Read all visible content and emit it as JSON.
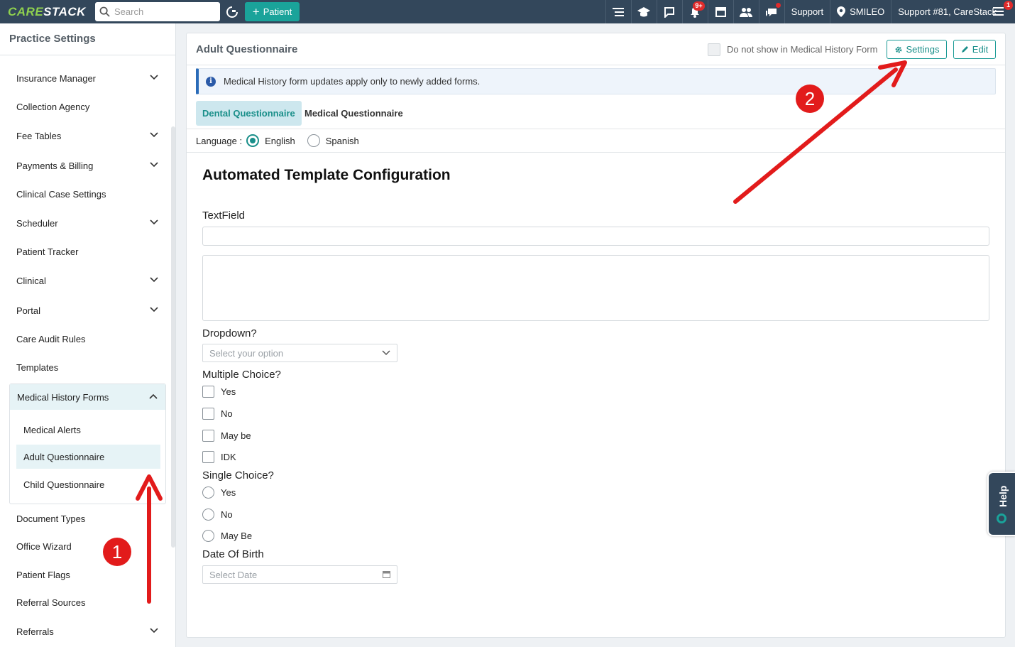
{
  "topbar": {
    "logo_part1": "CARE",
    "logo_part2": "STACK",
    "search_placeholder": "Search",
    "patient_button": "Patient",
    "notifications_badge": "9+",
    "support": "Support",
    "location": "SMILEO",
    "user": "Support #81, CareStack",
    "user_badge": "1"
  },
  "sidebar": {
    "title": "Practice Settings",
    "items": [
      {
        "label": "Insurance Manager",
        "expandable": true
      },
      {
        "label": "Collection Agency",
        "expandable": false
      },
      {
        "label": "Fee Tables",
        "expandable": true
      },
      {
        "label": "Payments & Billing",
        "expandable": true
      },
      {
        "label": "Clinical Case Settings",
        "expandable": false
      },
      {
        "label": "Scheduler",
        "expandable": true
      },
      {
        "label": "Patient Tracker",
        "expandable": false
      },
      {
        "label": "Clinical",
        "expandable": true
      },
      {
        "label": "Portal",
        "expandable": true
      },
      {
        "label": "Care Audit Rules",
        "expandable": false
      },
      {
        "label": "Templates",
        "expandable": false
      }
    ],
    "group": {
      "label": "Medical History Forms",
      "children": [
        "Medical Alerts",
        "Adult Questionnaire",
        "Child Questionnaire"
      ],
      "active_child": "Adult Questionnaire"
    },
    "items_after": [
      {
        "label": "Document Types",
        "expandable": false
      },
      {
        "label": "Office Wizard",
        "expandable": false
      },
      {
        "label": "Patient Flags",
        "expandable": false
      },
      {
        "label": "Referral Sources",
        "expandable": false
      },
      {
        "label": "Referrals",
        "expandable": true
      }
    ]
  },
  "panel": {
    "title": "Adult Questionnaire",
    "hide_checkbox_label": "Do not show in Medical History Form",
    "settings_button": "Settings",
    "edit_button": "Edit",
    "info_message": "Medical History form updates apply only to newly added forms.",
    "tabs": [
      {
        "label": "Dental Questionnaire",
        "active": true
      },
      {
        "label": "Medical Questionnaire",
        "active": false
      }
    ],
    "language_label": "Language :",
    "languages": [
      {
        "label": "English",
        "selected": true
      },
      {
        "label": "Spanish",
        "selected": false
      }
    ]
  },
  "form": {
    "title": "Automated Template Configuration",
    "textfield_label": "TextField",
    "dropdown_label": "Dropdown?",
    "dropdown_placeholder": "Select your option",
    "multiple_choice_label": "Multiple Choice?",
    "multiple_choice_options": [
      "Yes",
      "No",
      "May be",
      "IDK"
    ],
    "single_choice_label": "Single Choice?",
    "single_choice_options": [
      "Yes",
      "No",
      "May Be"
    ],
    "dob_label": "Date Of Birth",
    "dob_placeholder": "Select Date"
  },
  "help": {
    "label": "Help"
  },
  "annotations": {
    "step1": "1",
    "step2": "2",
    "color": "#e21b1b"
  },
  "colors": {
    "topbar": "#33475b",
    "accent": "#1aa39a",
    "active_bg": "#e6f3f6"
  }
}
